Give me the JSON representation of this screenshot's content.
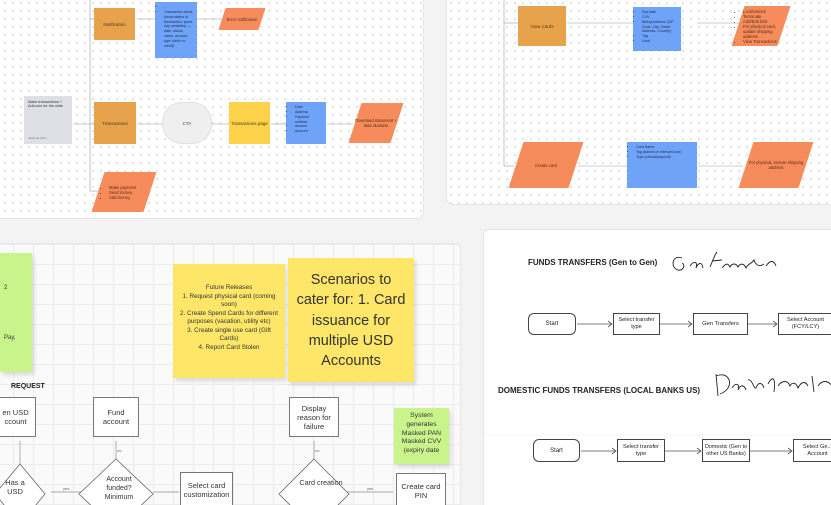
{
  "top_left_frame": {
    "notification": "Notification",
    "notification_details": [
      "...",
      "Transaction alerts (show status of transaction, spent day variables) — date, status, name, amount, type (debit or credit)"
    ],
    "error_notification": "Error notification",
    "transactions": "Transactions",
    "cta": "CTA",
    "transactions_page": "Transactions page",
    "transactions_page_details": [
      "Date",
      "Address",
      "Payment method",
      "amount",
      "account"
    ],
    "download_statement": "Download statement + date duration",
    "note_text": "Make transactions + Add-ons for the wide",
    "note_author": "Jasmine Asim",
    "make_payment_items": [
      "Make payment",
      "Send money",
      "Add money"
    ]
  },
  "top_right_frame": {
    "view_cards": "View Cards",
    "card_details": [
      "Exp date",
      "CVV",
      "Billing Address (ZIP Code, City, Street Address, Country)",
      "Tag",
      "Limit"
    ],
    "card_actions": [
      "Lock/Unlock",
      "Terminate",
      "Add/Edit limit",
      "For physical card, update shipping address",
      "View Transactions"
    ],
    "create_card": "Create card",
    "create_card_details": [
      "Card Name",
      "Tag (based on intended use)",
      "Type (virtual/physical)"
    ],
    "shipping_note": "For physical, ensure shipping address"
  },
  "middle_board": {
    "green_note_lines": [
      "2",
      "Pay,"
    ],
    "future_releases": {
      "title": "Future Releases",
      "items": [
        "1. Request physical card (coming soon)",
        "2. Create Spend Cards for different purposes (vacation, utility etc)",
        "3. Create single use card (Gift Cards)",
        "4. Report Card Stolen"
      ]
    },
    "scenarios": "Scenarios to cater for: 1. Card issuance for multiple USD Accounts",
    "request_label": "REQUEST",
    "usd_account": "en USD ccount",
    "fund_account": "Fund account",
    "display_reason": "Display reason for failure",
    "system_generates": "System generates Masked PAN Masked CVV (expiry date",
    "has_usd": "Has a USD",
    "account_funded": "Account funded? Minimum",
    "select_card": "Select card customization",
    "card_creation": "Card creation",
    "create_card_pin": "Create card PIN",
    "yes": "yes",
    "no": "no"
  },
  "right_board": {
    "funds_title": "FUNDS TRANSFERS (Gen to Gen)",
    "funds_signature": "Gen transfer",
    "start_1": "Start",
    "select_transfer_type_1": "Select transfer type",
    "gen_transfers": "Gen Transfers",
    "select_account": "Select Account (FCY/LCY)",
    "domestic_title": "DOMESTIC FUNDS TRANSFERS (LOCAL BANKS US)",
    "domestic_signature": "Domestic",
    "start_2": "Start",
    "select_transfer_type_2": "Select transfer type",
    "domestic_node": "Domestic (Gen to other US Banks)",
    "select_gen": "Select Ge... Account"
  }
}
